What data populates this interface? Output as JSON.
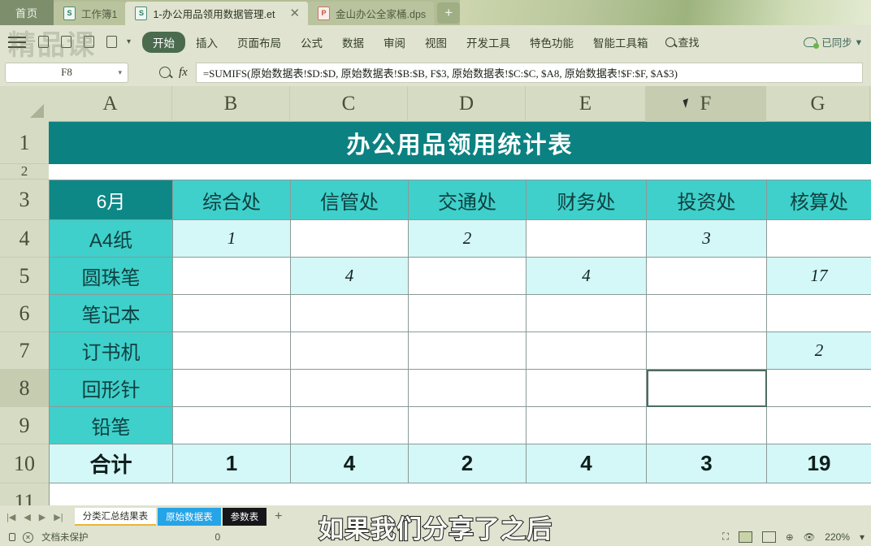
{
  "window": {
    "home_tab": "首页",
    "tabs": [
      {
        "label": "工作簿1",
        "type": "et",
        "active": false,
        "closable": false
      },
      {
        "label": "1-办公用品领用数据管理.et",
        "type": "et",
        "active": true,
        "closable": true
      },
      {
        "label": "金山办公全家桶.dps",
        "type": "dps",
        "active": false,
        "closable": false
      }
    ],
    "new_tab_label": "+",
    "watermark": "精品课"
  },
  "ribbon": {
    "items": [
      "开始",
      "插入",
      "页面布局",
      "公式",
      "数据",
      "审阅",
      "视图",
      "开发工具",
      "特色功能",
      "智能工具箱"
    ],
    "active": "开始",
    "find_label": "查找",
    "sync_label": "已同步",
    "sync_caret": "▾"
  },
  "formula_bar": {
    "name_box": "F8",
    "name_box_caret": "▾",
    "fx_label": "fx",
    "formula": "=SUMIFS(原始数据表!$D:$D, 原始数据表!$B:$B, F$3, 原始数据表!$C:$C, $A8, 原始数据表!$F:$F, $A$3)"
  },
  "grid": {
    "columns": [
      "A",
      "B",
      "C",
      "D",
      "E",
      "F",
      "G"
    ],
    "selected_column": "F",
    "rows": [
      "1",
      "2",
      "3",
      "4",
      "5",
      "6",
      "7",
      "8",
      "9",
      "10",
      "11"
    ],
    "selected_row": "8",
    "selected_cell": "F8"
  },
  "sheet": {
    "title": "办公用品领用统计表",
    "title_bg": "#0c8181",
    "header_bg": "#3fd0cb",
    "fill_color": "#d4f7f7",
    "headers": [
      "6月",
      "综合处",
      "信管处",
      "交通处",
      "财务处",
      "投资处",
      "核算处"
    ],
    "rows": [
      {
        "label": "A4纸",
        "values": [
          "1",
          "",
          "2",
          "",
          "3",
          ""
        ],
        "filled": [
          true,
          false,
          true,
          false,
          true,
          false
        ]
      },
      {
        "label": "圆珠笔",
        "values": [
          "",
          "4",
          "",
          "4",
          "",
          "17"
        ],
        "filled": [
          false,
          true,
          false,
          true,
          false,
          true
        ]
      },
      {
        "label": "笔记本",
        "values": [
          "",
          "",
          "",
          "",
          "",
          ""
        ],
        "filled": [
          false,
          false,
          false,
          false,
          false,
          false
        ]
      },
      {
        "label": "订书机",
        "values": [
          "",
          "",
          "",
          "",
          "",
          "2"
        ],
        "filled": [
          false,
          false,
          false,
          false,
          false,
          true
        ]
      },
      {
        "label": "回形针",
        "values": [
          "",
          "",
          "",
          "",
          "",
          ""
        ],
        "filled": [
          false,
          false,
          false,
          false,
          false,
          false
        ]
      },
      {
        "label": "铅笔",
        "values": [
          "",
          "",
          "",
          "",
          "",
          ""
        ],
        "filled": [
          false,
          false,
          false,
          false,
          false,
          false
        ]
      }
    ],
    "total_label": "合计",
    "totals": [
      "1",
      "4",
      "2",
      "4",
      "3",
      "19"
    ]
  },
  "sheet_tabs": {
    "items": [
      {
        "label": "分类汇总结果表",
        "style": "active"
      },
      {
        "label": "原始数据表",
        "style": "blue"
      },
      {
        "label": "参数表",
        "style": "black"
      }
    ],
    "add_label": "+"
  },
  "status_bar": {
    "protection": "文档未保护",
    "count": "0",
    "zoom": "220%",
    "zoom_caret": "▾"
  },
  "caption": "如果我们分享了之后"
}
